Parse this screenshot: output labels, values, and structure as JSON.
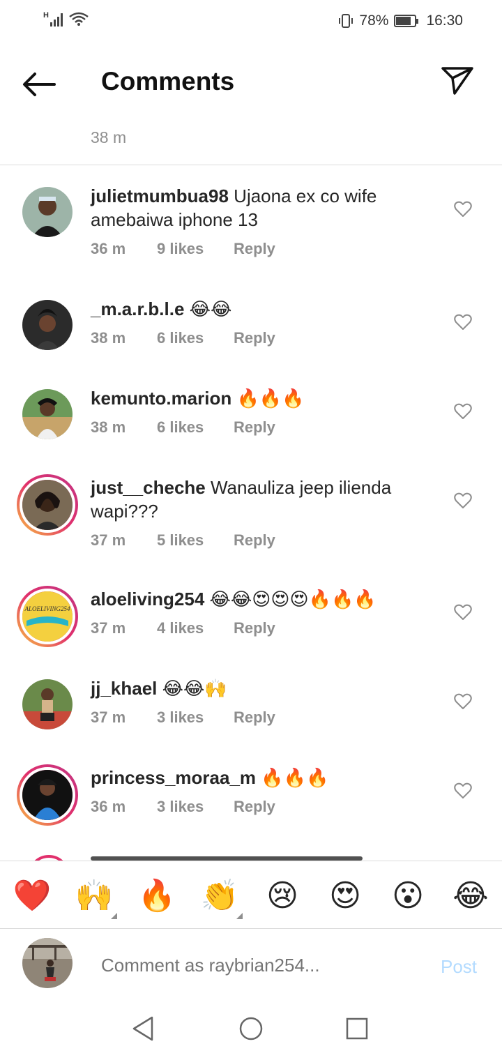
{
  "status_bar": {
    "network": "H",
    "battery": "78%",
    "battery_level": 0.78,
    "time": "16:30"
  },
  "header": {
    "title": "Comments"
  },
  "caption": {
    "time": "38 m"
  },
  "comments": [
    {
      "user": "julietmumbua98",
      "text": " Ujaona ex co wife amebaiwa iphone 13",
      "time": "36 m",
      "likes": "9 likes",
      "reply": "Reply"
    },
    {
      "user": "_m.a.r.b.l.e",
      "text": " 😂😂",
      "time": "38 m",
      "likes": "6 likes",
      "reply": "Reply"
    },
    {
      "user": "kemunto.marion",
      "text": " 🔥🔥🔥",
      "time": "38 m",
      "likes": "6 likes",
      "reply": "Reply"
    },
    {
      "user": "just__cheche",
      "text": " Wanauliza jeep ilienda wapi???",
      "time": "37 m",
      "likes": "5 likes",
      "reply": "Reply"
    },
    {
      "user": "aloeliving254",
      "text": " 😂😂😍😍😍🔥🔥🔥",
      "time": "37 m",
      "likes": "4 likes",
      "reply": "Reply"
    },
    {
      "user": "jj_khael",
      "text": " 😂😂🙌",
      "time": "37 m",
      "likes": "3 likes",
      "reply": "Reply"
    },
    {
      "user": "princess_moraa_m",
      "text": " 🔥🔥🔥",
      "time": "36 m",
      "likes": "3 likes",
      "reply": "Reply"
    }
  ],
  "reactions": [
    "❤️",
    "🙌",
    "🔥",
    "👏",
    "😢",
    "😍",
    "😮",
    "😂"
  ],
  "composer": {
    "placeholder": "Comment as raybrian254...",
    "post_label": "Post"
  },
  "colors": {
    "text": "#262626",
    "secondary": "#8e8e8e",
    "post_disabled": "#b3dbff",
    "story_ring_start": "#f9c440",
    "story_ring_end": "#c13584"
  }
}
